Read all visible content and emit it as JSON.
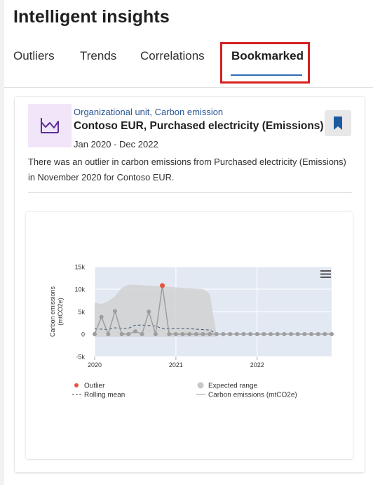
{
  "panel": {
    "title": "Intelligent insights"
  },
  "tabs": [
    {
      "label": "Outliers",
      "active": false
    },
    {
      "label": "Trends",
      "active": false
    },
    {
      "label": "Correlations",
      "active": false
    },
    {
      "label": "Bookmarked",
      "active": true
    }
  ],
  "card": {
    "icon": "area-chart-icon",
    "subtitle": "Organizational unit, Carbon emission",
    "title": "Contoso EUR, Purchased electricity (Emissions)",
    "date_range": "Jan 2020 - Dec 2022",
    "description": "There was an outlier in carbon emissions from Purchased electricity (Emissions) in November 2020 for Contoso EUR.",
    "bookmark_icon": "bookmark-filled-icon",
    "bookmarked": true
  },
  "colors": {
    "accent": "#2f6db5",
    "highlight_box": "#d42020",
    "bookmark": "#1b5aa0",
    "icon_bg": "#f1e5fa",
    "icon_stroke": "#5c2e91",
    "outlier": "#e8543f",
    "series": "#9e9e9e",
    "rolling_mean": "#3b5573",
    "expected_range": "#d0d0d0",
    "plot_bg": "#e3e9f3"
  },
  "chart_data": {
    "type": "line",
    "ylabel": "Carbon emissions (mtCO2e)",
    "y_ticks": [
      "15k",
      "10k",
      "5k",
      "0",
      "-5k"
    ],
    "y_tick_values": [
      15000,
      10000,
      5000,
      0,
      -5000
    ],
    "ylim": [
      -5000,
      15000
    ],
    "x_ticks": [
      "2020",
      "2021",
      "2022"
    ],
    "x_tick_dates": [
      "2020-01",
      "2021-01",
      "2022-01"
    ],
    "xlim": [
      "2020-01",
      "2022-12"
    ],
    "grid": true,
    "legend_position": "bottom",
    "menu_icon": "hamburger-menu-icon",
    "x": [
      "2020-01",
      "2020-02",
      "2020-03",
      "2020-04",
      "2020-05",
      "2020-06",
      "2020-07",
      "2020-08",
      "2020-09",
      "2020-10",
      "2020-11",
      "2020-12",
      "2021-01",
      "2021-02",
      "2021-03",
      "2021-04",
      "2021-05",
      "2021-06",
      "2021-07",
      "2021-08",
      "2021-09",
      "2021-10",
      "2021-11",
      "2021-12",
      "2022-01",
      "2022-02",
      "2022-03",
      "2022-04",
      "2022-05",
      "2022-06",
      "2022-07",
      "2022-08",
      "2022-09",
      "2022-10",
      "2022-11",
      "2022-12"
    ],
    "series": [
      {
        "name": "Carbon emissions (mtCO2e)",
        "values": [
          0,
          3800,
          0,
          5100,
          0,
          0,
          600,
          0,
          5000,
          0,
          10800,
          0,
          0,
          0,
          0,
          0,
          0,
          0,
          0,
          0,
          0,
          0,
          0,
          0,
          0,
          0,
          0,
          0,
          0,
          0,
          0,
          0,
          0,
          0,
          0,
          0
        ]
      },
      {
        "name": "Rolling mean",
        "values": [
          1200,
          1100,
          1000,
          1400,
          1300,
          1300,
          2000,
          2000,
          1900,
          1800,
          1200,
          1200,
          1200,
          1200,
          1200,
          1100,
          1000,
          900,
          0,
          null,
          null,
          null,
          null,
          null,
          null,
          null,
          null,
          null,
          null,
          null,
          null,
          null,
          null,
          null,
          null,
          null
        ]
      }
    ],
    "expected_range": {
      "lower": [
        -600,
        -600,
        -600,
        -600,
        -600,
        -600,
        -600,
        -600,
        -600,
        -600,
        -600,
        -600,
        -600,
        -600,
        -600,
        -600,
        -600,
        -600,
        -600
      ],
      "upper": [
        7000,
        6700,
        7300,
        8400,
        10300,
        11000,
        11000,
        10900,
        10800,
        10700,
        10600,
        10500,
        10400,
        10300,
        10200,
        10100,
        10000,
        9000,
        0
      ]
    },
    "outlier": {
      "x": "2020-11",
      "value": 10800
    },
    "legend": [
      {
        "name": "Outlier",
        "marker": "dot"
      },
      {
        "name": "Expected range",
        "marker": "dot"
      },
      {
        "name": "Rolling mean",
        "marker": "dashed-line"
      },
      {
        "name": "Carbon emissions (mtCO2e)",
        "marker": "line"
      }
    ]
  }
}
